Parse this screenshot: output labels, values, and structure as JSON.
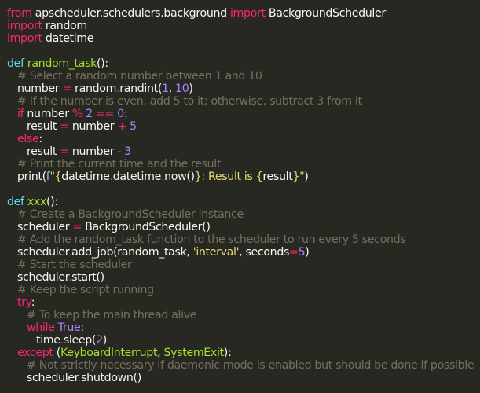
{
  "editor": {
    "lines": [
      {
        "indent": 0,
        "tokens": [
          {
            "t": "kw",
            "v": "from"
          },
          {
            "t": "tx",
            "v": " apscheduler.schedulers.background "
          },
          {
            "t": "kw",
            "v": "import"
          },
          {
            "t": "tx",
            "v": " BackgroundScheduler"
          }
        ]
      },
      {
        "indent": 0,
        "tokens": [
          {
            "t": "kw",
            "v": "import"
          },
          {
            "t": "tx",
            "v": " random"
          }
        ]
      },
      {
        "indent": 0,
        "tokens": [
          {
            "t": "kw",
            "v": "import"
          },
          {
            "t": "tx",
            "v": " datetime"
          }
        ]
      },
      {
        "indent": 0,
        "tokens": []
      },
      {
        "indent": 0,
        "tokens": [
          {
            "t": "kb",
            "v": "def"
          },
          {
            "t": "tx",
            "v": " "
          },
          {
            "t": "fn",
            "v": "random_task"
          },
          {
            "t": "tx",
            "v": "():"
          }
        ]
      },
      {
        "indent": 1,
        "tokens": [
          {
            "t": "cm",
            "v": "# Select a random number between 1 and 10"
          }
        ]
      },
      {
        "indent": 1,
        "tokens": [
          {
            "t": "tx",
            "v": "number "
          },
          {
            "t": "op",
            "v": "="
          },
          {
            "t": "tx",
            "v": " random"
          },
          {
            "t": "op",
            "v": "."
          },
          {
            "t": "tx",
            "v": "randint("
          },
          {
            "t": "num",
            "v": "1"
          },
          {
            "t": "tx",
            "v": ", "
          },
          {
            "t": "num",
            "v": "10"
          },
          {
            "t": "tx",
            "v": ")"
          }
        ]
      },
      {
        "indent": 1,
        "tokens": [
          {
            "t": "cm",
            "v": "# If the number is even, add 5 to it; otherwise, subtract 3 from it"
          }
        ]
      },
      {
        "indent": 1,
        "tokens": [
          {
            "t": "kw",
            "v": "if"
          },
          {
            "t": "tx",
            "v": " number "
          },
          {
            "t": "op",
            "v": "%"
          },
          {
            "t": "tx",
            "v": " "
          },
          {
            "t": "num",
            "v": "2"
          },
          {
            "t": "tx",
            "v": " "
          },
          {
            "t": "op",
            "v": "=="
          },
          {
            "t": "tx",
            "v": " "
          },
          {
            "t": "num",
            "v": "0"
          },
          {
            "t": "tx",
            "v": ":"
          }
        ]
      },
      {
        "indent": 2,
        "tokens": [
          {
            "t": "tx",
            "v": "result "
          },
          {
            "t": "op",
            "v": "="
          },
          {
            "t": "tx",
            "v": " number "
          },
          {
            "t": "op",
            "v": "+"
          },
          {
            "t": "tx",
            "v": " "
          },
          {
            "t": "num",
            "v": "5"
          }
        ]
      },
      {
        "indent": 1,
        "tokens": [
          {
            "t": "kw",
            "v": "else"
          },
          {
            "t": "tx",
            "v": ":"
          }
        ]
      },
      {
        "indent": 2,
        "tokens": [
          {
            "t": "tx",
            "v": "result "
          },
          {
            "t": "op",
            "v": "="
          },
          {
            "t": "tx",
            "v": " number "
          },
          {
            "t": "op",
            "v": "-"
          },
          {
            "t": "tx",
            "v": " "
          },
          {
            "t": "num",
            "v": "3"
          }
        ]
      },
      {
        "indent": 1,
        "tokens": [
          {
            "t": "cm",
            "v": "# Print the current time and the result"
          }
        ]
      },
      {
        "indent": 1,
        "tokens": [
          {
            "t": "tx",
            "v": "print("
          },
          {
            "t": "kb",
            "v": "f"
          },
          {
            "t": "str",
            "v": "\"{"
          },
          {
            "t": "tx",
            "v": "datetime"
          },
          {
            "t": "op",
            "v": "."
          },
          {
            "t": "tx",
            "v": "datetime"
          },
          {
            "t": "op",
            "v": "."
          },
          {
            "t": "tx",
            "v": "now()"
          },
          {
            "t": "str",
            "v": "}: Result is {"
          },
          {
            "t": "tx",
            "v": "result"
          },
          {
            "t": "str",
            "v": "}\""
          },
          {
            "t": "tx",
            "v": ")"
          }
        ]
      },
      {
        "indent": 0,
        "tokens": []
      },
      {
        "indent": 0,
        "tokens": [
          {
            "t": "kb",
            "v": "def"
          },
          {
            "t": "tx",
            "v": " "
          },
          {
            "t": "fn",
            "v": "xxx"
          },
          {
            "t": "tx",
            "v": "():"
          }
        ]
      },
      {
        "indent": 1,
        "tokens": [
          {
            "t": "cm",
            "v": "# Create a BackgroundScheduler instance"
          }
        ]
      },
      {
        "indent": 1,
        "tokens": [
          {
            "t": "tx",
            "v": "scheduler "
          },
          {
            "t": "op",
            "v": "="
          },
          {
            "t": "tx",
            "v": " BackgroundScheduler()"
          }
        ]
      },
      {
        "indent": 1,
        "tokens": [
          {
            "t": "cm",
            "v": "# Add the random_task function to the scheduler to run every 5 seconds"
          }
        ]
      },
      {
        "indent": 1,
        "tokens": [
          {
            "t": "tx",
            "v": "scheduler"
          },
          {
            "t": "op",
            "v": "."
          },
          {
            "t": "tx",
            "v": "add_job(random_task, "
          },
          {
            "t": "str",
            "v": "'interval'"
          },
          {
            "t": "tx",
            "v": ", seconds"
          },
          {
            "t": "op",
            "v": "="
          },
          {
            "t": "num",
            "v": "5"
          },
          {
            "t": "tx",
            "v": ")"
          }
        ]
      },
      {
        "indent": 1,
        "tokens": [
          {
            "t": "cm",
            "v": "# Start the scheduler"
          }
        ]
      },
      {
        "indent": 1,
        "tokens": [
          {
            "t": "tx",
            "v": "scheduler"
          },
          {
            "t": "op",
            "v": "."
          },
          {
            "t": "tx",
            "v": "start()"
          }
        ]
      },
      {
        "indent": 1,
        "tokens": [
          {
            "t": "cm",
            "v": "# Keep the script running"
          }
        ]
      },
      {
        "indent": 1,
        "tokens": [
          {
            "t": "kw",
            "v": "try"
          },
          {
            "t": "tx",
            "v": ":"
          }
        ]
      },
      {
        "indent": 2,
        "tokens": [
          {
            "t": "cm",
            "v": "# To keep the main thread alive"
          }
        ]
      },
      {
        "indent": 2,
        "tokens": [
          {
            "t": "kw",
            "v": "while"
          },
          {
            "t": "tx",
            "v": " "
          },
          {
            "t": "num",
            "v": "True"
          },
          {
            "t": "tx",
            "v": ":"
          }
        ]
      },
      {
        "indent": 3,
        "tokens": [
          {
            "t": "tx",
            "v": "time"
          },
          {
            "t": "op",
            "v": "."
          },
          {
            "t": "tx",
            "v": "sleep("
          },
          {
            "t": "num",
            "v": "2"
          },
          {
            "t": "tx",
            "v": ")"
          }
        ]
      },
      {
        "indent": 1,
        "tokens": [
          {
            "t": "kw",
            "v": "except"
          },
          {
            "t": "tx",
            "v": " ("
          },
          {
            "t": "fn",
            "v": "KeyboardInterrupt"
          },
          {
            "t": "tx",
            "v": ", "
          },
          {
            "t": "fn",
            "v": "SystemExit"
          },
          {
            "t": "tx",
            "v": "):"
          }
        ]
      },
      {
        "indent": 2,
        "tokens": [
          {
            "t": "cm",
            "v": "# Not strictly necessary if daemonic mode is enabled but should be done if possible"
          }
        ]
      },
      {
        "indent": 2,
        "tokens": [
          {
            "t": "tx",
            "v": "scheduler"
          },
          {
            "t": "op",
            "v": "."
          },
          {
            "t": "tx",
            "v": "shutdown()"
          }
        ]
      }
    ]
  }
}
